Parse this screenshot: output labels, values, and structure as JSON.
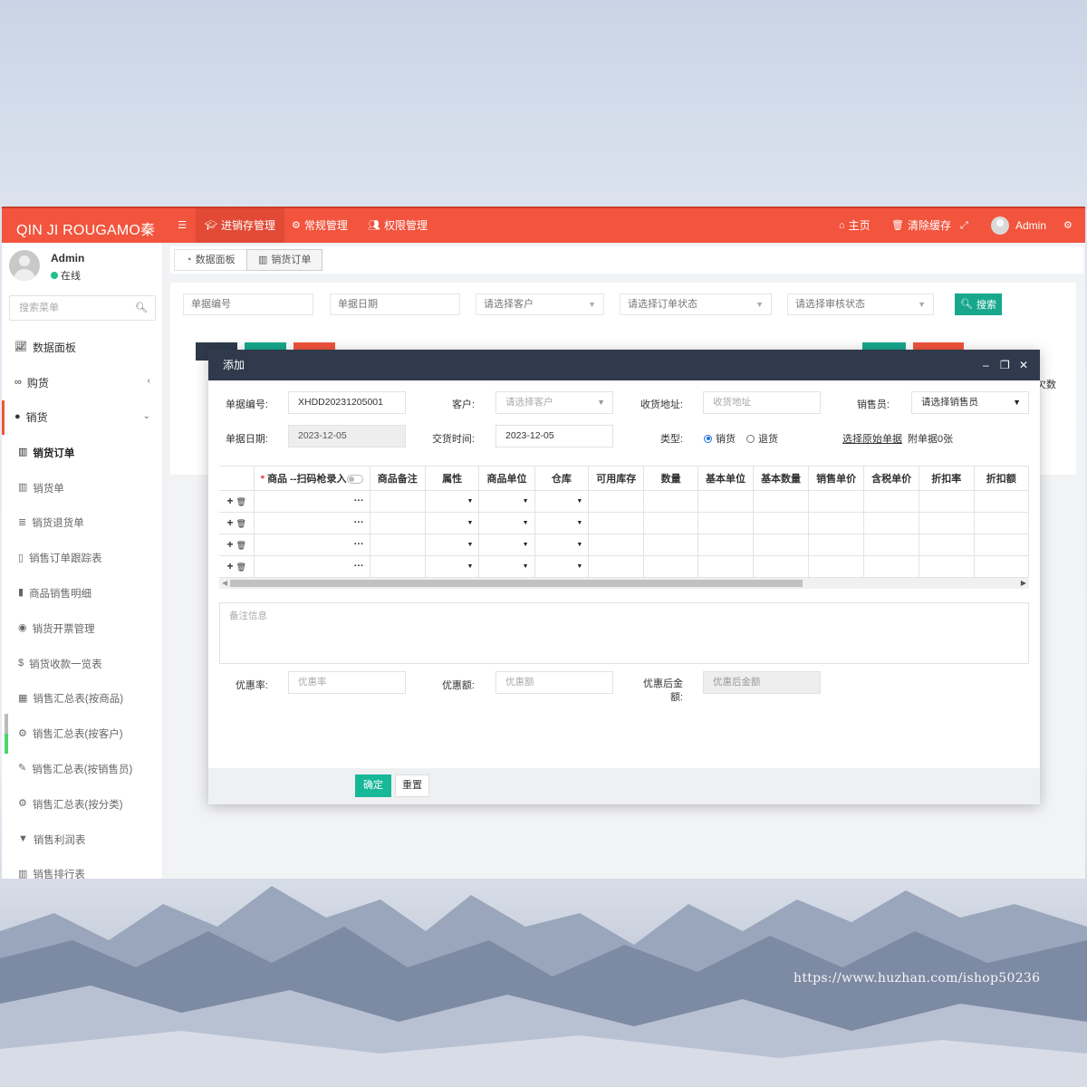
{
  "app": {
    "brand": "QIN JI ROUGAMO秦",
    "topnav": [
      {
        "label": "进销存管理",
        "icon": "graduation-cap-icon"
      },
      {
        "label": "常规管理",
        "icon": "cogs-icon"
      },
      {
        "label": "权限管理",
        "icon": "users-icon"
      }
    ],
    "topright": {
      "home": "主页",
      "clear_cache": "清除缓存",
      "user": "Admin"
    },
    "accent_color": "#f2543d"
  },
  "sidebar": {
    "user_name": "Admin",
    "user_status": "在线",
    "search_placeholder": "搜索菜单",
    "items": [
      {
        "label": "数据面板",
        "icon": "area-chart-icon"
      },
      {
        "label": "购货",
        "icon": "binoculars-icon"
      },
      {
        "label": "销货",
        "icon": "apple-icon"
      },
      {
        "label": "销货订单",
        "icon": "bar-chart-icon"
      },
      {
        "label": "销货单",
        "icon": "bar-chart-icon"
      },
      {
        "label": "销货退货单",
        "icon": "database-icon"
      },
      {
        "label": "销售订单跟踪表",
        "icon": "file-icon"
      },
      {
        "label": "商品销售明细",
        "icon": "book-icon"
      },
      {
        "label": "销货开票管理",
        "icon": "chrome-icon"
      },
      {
        "label": "销货收款一览表",
        "icon": "dollar-icon"
      },
      {
        "label": "销售汇总表(按商品)",
        "icon": "calculator-icon"
      },
      {
        "label": "销售汇总表(按客户)",
        "icon": "cogs-icon"
      },
      {
        "label": "销售汇总表(按销售员)",
        "icon": "eyedropper-icon"
      },
      {
        "label": "销售汇总表(按分类)",
        "icon": "cogs-icon"
      },
      {
        "label": "销售利润表",
        "icon": "bookmark-icon"
      },
      {
        "label": "销售排行表",
        "icon": "bar-chart-icon"
      }
    ]
  },
  "tabs": [
    {
      "label": "数据面板",
      "icon": "dashboard-icon"
    },
    {
      "label": "销货订单",
      "icon": "bar-chart-icon"
    }
  ],
  "filters": {
    "doc_no": "单据编号",
    "doc_date": "单据日期",
    "customer": "请选择客户",
    "order_status": "请选择订单状态",
    "audit_status": "请选择审核状态",
    "search_btn": "搜索",
    "partial_col": "欠数"
  },
  "modal": {
    "title": "添加",
    "fields": {
      "doc_no_label": "单据编号:",
      "doc_no_value": "XHDD20231205001",
      "customer_label": "客户:",
      "customer_placeholder": "请选择客户",
      "address_label": "收货地址:",
      "address_placeholder": "收货地址",
      "salesman_label": "销售员:",
      "salesman_value": "请选择销售员",
      "doc_date_label": "单据日期:",
      "doc_date_value": "2023-12-05",
      "deliver_label": "交货时间:",
      "deliver_value": "2023-12-05",
      "type_label": "类型:",
      "type_options": [
        "销货",
        "退货"
      ],
      "select_source": "选择原始单据",
      "attachments": "附单据0张"
    },
    "grid": {
      "columns": [
        "商品 --扫码枪录入",
        "商品备注",
        "属性",
        "商品单位",
        "仓库",
        "可用库存",
        "数量",
        "基本单位",
        "基本数量",
        "销售单价",
        "含税单价",
        "折扣率",
        "折扣额"
      ],
      "rows": 4,
      "ellipsis": "···"
    },
    "remark_placeholder": "备注信息",
    "discount": {
      "rate_label": "优惠率:",
      "rate_placeholder": "优惠率",
      "amount_label": "优惠额:",
      "amount_placeholder": "优惠额",
      "after_label": "优惠后金额:",
      "after_placeholder": "优惠后金额"
    },
    "buttons": {
      "ok": "确定",
      "reset": "重置"
    }
  },
  "watermark": "https://www.huzhan.com/ishop50236"
}
